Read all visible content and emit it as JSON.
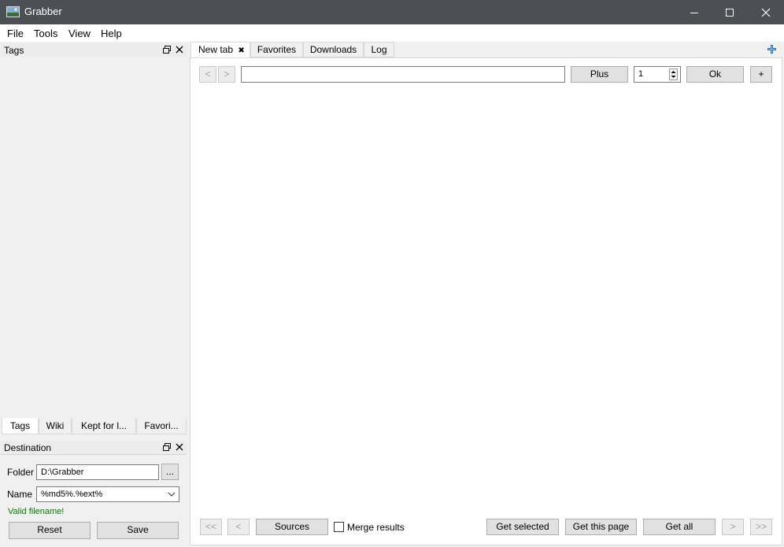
{
  "window": {
    "title": "Grabber"
  },
  "menu": [
    "File",
    "Tools",
    "View",
    "Help"
  ],
  "tags_dock": {
    "title": "Tags",
    "bottom_tabs": [
      "Tags",
      "Wiki",
      "Kept for l...",
      "Favori..."
    ]
  },
  "destination_dock": {
    "title": "Destination",
    "folder_label": "Folder",
    "folder_value": "D:\\Grabber",
    "browse_label": "...",
    "name_label": "Name",
    "name_value": "%md5%.%ext%",
    "status": "Valid filename!",
    "reset_label": "Reset",
    "save_label": "Save"
  },
  "main_tabs": [
    "New tab",
    "Favorites",
    "Downloads",
    "Log"
  ],
  "search": {
    "prev": "<",
    "next": ">",
    "query": "",
    "plus_label": "Plus",
    "page": "1",
    "ok_label": "Ok",
    "add_label": "+"
  },
  "bottom_bar": {
    "first": "<<",
    "prev": "<",
    "sources": "Sources",
    "merge_label": "Merge results",
    "get_selected": "Get selected",
    "get_page": "Get this page",
    "get_all": "Get all",
    "next": ">",
    "last": ">>"
  },
  "colors": {
    "titlebar": "#4a5053",
    "valid": "#008000",
    "accent_plus": "#1e6fd9"
  }
}
